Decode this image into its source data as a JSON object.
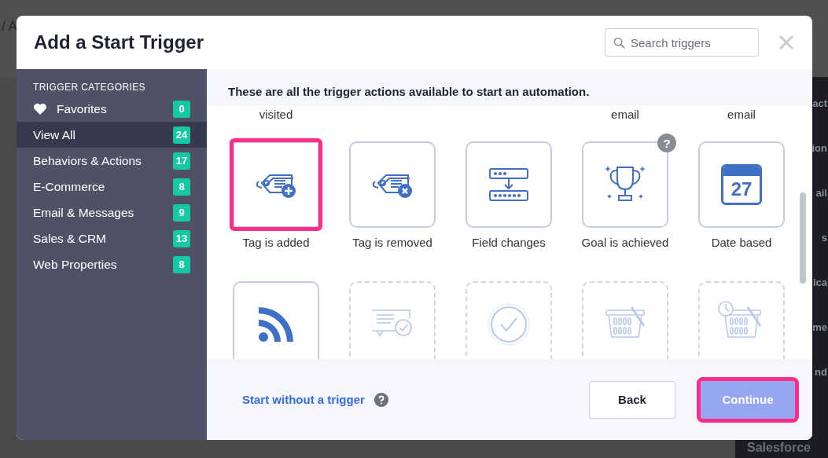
{
  "backdrop": {
    "breadcrumb": "/ A",
    "side_fragments": [
      "act",
      "ion",
      "ail",
      "s",
      "ica",
      "me",
      "nd"
    ],
    "footer_text": "Salesforce"
  },
  "dialog": {
    "title": "Add a Start Trigger",
    "search": {
      "placeholder": "Search triggers"
    },
    "sidebar": {
      "heading": "TRIGGER CATEGORIES",
      "items": [
        {
          "label": "Favorites",
          "count": "0",
          "kind": "favorites",
          "selected": false
        },
        {
          "label": "View All",
          "count": "24",
          "kind": "category",
          "selected": true
        },
        {
          "label": "Behaviors & Actions",
          "count": "17",
          "kind": "category",
          "selected": false
        },
        {
          "label": "E-Commerce",
          "count": "8",
          "kind": "category",
          "selected": false
        },
        {
          "label": "Email & Messages",
          "count": "9",
          "kind": "category",
          "selected": false
        },
        {
          "label": "Sales & CRM",
          "count": "13",
          "kind": "category",
          "selected": false
        },
        {
          "label": "Web Properties",
          "count": "8",
          "kind": "category",
          "selected": false
        }
      ]
    },
    "intro": "These are all the trigger actions available to start an automation.",
    "previous_row_labels": [
      {
        "kind": "label",
        "label": "visited"
      },
      {
        "kind": "blank"
      },
      {
        "kind": "blank"
      },
      {
        "kind": "label",
        "label": "email"
      },
      {
        "kind": "label",
        "label": "email"
      }
    ],
    "tiles": [
      {
        "label": "Tag is added",
        "kind": "tag-add",
        "available": true,
        "highlighted": true
      },
      {
        "label": "Tag is removed",
        "kind": "tag-remove",
        "available": true,
        "highlighted": false
      },
      {
        "label": "Field changes",
        "kind": "field",
        "available": true,
        "highlighted": false
      },
      {
        "label": "Goal is achieved",
        "kind": "trophy",
        "available": true,
        "highlighted": false,
        "help": "?"
      },
      {
        "label": "Date based",
        "kind": "calendar",
        "date": "27",
        "available": true,
        "highlighted": false
      },
      {
        "kind": "rss",
        "available": true,
        "highlighted": false
      },
      {
        "kind": "chat-check",
        "available": false,
        "highlighted": false
      },
      {
        "kind": "check-circle",
        "available": false,
        "highlighted": false
      },
      {
        "kind": "basket",
        "available": false,
        "highlighted": false
      },
      {
        "kind": "basket-clock",
        "available": false,
        "highlighted": false
      }
    ],
    "footer": {
      "link": "Start without a trigger",
      "buttons": [
        {
          "label": "Back",
          "kind": "secondary",
          "highlighted": false
        },
        {
          "label": "Continue",
          "kind": "primary",
          "highlighted": true
        }
      ]
    }
  }
}
